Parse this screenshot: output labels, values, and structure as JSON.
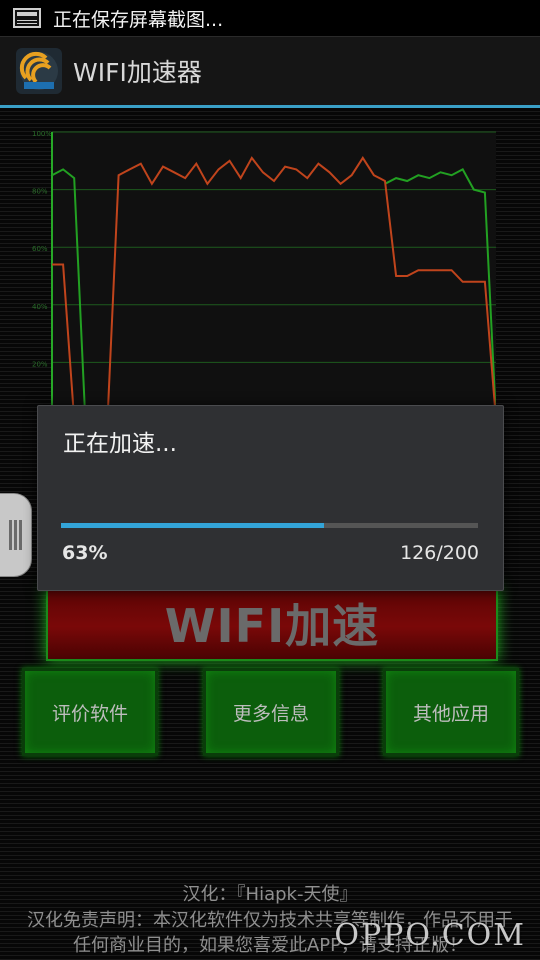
{
  "status_bar": {
    "text": "正在保存屏幕截图...",
    "icon": "screenshot-icon"
  },
  "action_bar": {
    "title": "WIFI加速器",
    "logo": "wifi-logo-icon",
    "accent_color": "#3aa0c8"
  },
  "chart_data": {
    "type": "line",
    "title": "",
    "xlabel": "",
    "ylabel": "",
    "ylim": [
      0,
      100
    ],
    "y_ticks": [
      "100%",
      "80%",
      "60%",
      "40%",
      "20%"
    ],
    "grid": true,
    "series": [
      {
        "color": "#22a022",
        "x": [
          0,
          1,
          2,
          3,
          4,
          5,
          6,
          7,
          8,
          9,
          10,
          11,
          12,
          13,
          14,
          15,
          16,
          17,
          18,
          19,
          20,
          21,
          22,
          23,
          24,
          25,
          26,
          27,
          28,
          29,
          30,
          31,
          32,
          33,
          34,
          35,
          36,
          37,
          38,
          39,
          40
        ],
        "values": [
          85,
          87,
          84,
          0,
          null,
          null,
          null,
          null,
          null,
          null,
          null,
          null,
          null,
          null,
          null,
          null,
          null,
          null,
          null,
          null,
          null,
          null,
          null,
          null,
          null,
          null,
          null,
          null,
          null,
          null,
          82,
          84,
          83,
          85,
          84,
          86,
          85,
          87,
          80,
          79,
          0
        ]
      },
      {
        "color": "#c0441c",
        "x": [
          0,
          1,
          2,
          3,
          4,
          5,
          6,
          7,
          8,
          9,
          10,
          11,
          12,
          13,
          14,
          15,
          16,
          17,
          18,
          19,
          20,
          21,
          22,
          23,
          24,
          25,
          26,
          27,
          28,
          29,
          30,
          31,
          32,
          33,
          34,
          35,
          36,
          37,
          38,
          39,
          40
        ],
        "values": [
          54,
          54,
          0,
          0,
          0,
          0,
          85,
          87,
          89,
          82,
          88,
          86,
          84,
          89,
          82,
          87,
          90,
          84,
          91,
          86,
          83,
          88,
          87,
          84,
          89,
          86,
          82,
          85,
          91,
          85,
          83,
          50,
          50,
          52,
          52,
          52,
          52,
          48,
          48,
          48,
          0
        ]
      }
    ]
  },
  "main_button": {
    "label": "WIFI加速"
  },
  "buttons": [
    {
      "label": "评价软件"
    },
    {
      "label": "更多信息"
    },
    {
      "label": "其他应用"
    }
  ],
  "dialog": {
    "title": "正在加速...",
    "progress_fraction": 0.63,
    "percent_text": "63%",
    "count_text": "126/200",
    "progress_color": "#33a4d8"
  },
  "footer": {
    "credit": "汉化：『Hiapk-天使』",
    "disclaimer_line1": "汉化免责声明：本汉化软件仅为技术共享等制作，作品不用于",
    "disclaimer_line2": "任何商业目的，如果您喜爱此APP，请支持正版！",
    "watermark": "OPPO.COM"
  }
}
